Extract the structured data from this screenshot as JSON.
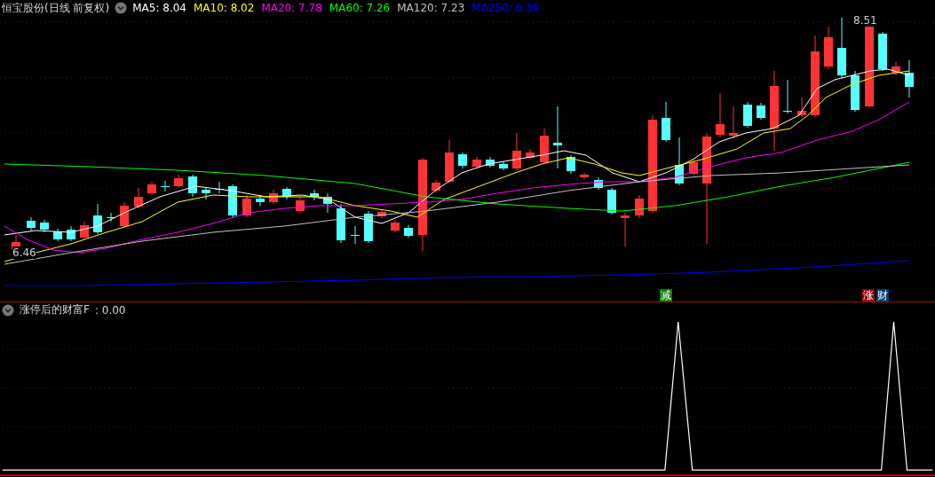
{
  "main_panel": {
    "title": "恒宝股份(日线 前复权)",
    "moving_averages": [
      {
        "label": "MA5:",
        "value": "8.04",
        "color": "#ffffff"
      },
      {
        "label": "MA10:",
        "value": "8.02",
        "color": "#ffff00"
      },
      {
        "label": "MA20:",
        "value": "7.78",
        "color": "#ff00ff"
      },
      {
        "label": "MA60:",
        "value": "7.26",
        "color": "#00ff00"
      },
      {
        "label": "MA120:",
        "value": "7.23",
        "color": "#c0c0c0"
      },
      {
        "label": "MA250:",
        "value": "6.39",
        "color": "#0000ff"
      }
    ],
    "high_label": "8.51",
    "low_label": "6.46",
    "signals": [
      {
        "text": "减",
        "color": "#008000"
      },
      {
        "text": "涨",
        "color": "#990000"
      },
      {
        "text": "财",
        "color": "#003a70"
      }
    ]
  },
  "indicator_panel": {
    "title": "涨停后的财富F",
    "value": ": 0.00"
  }
}
